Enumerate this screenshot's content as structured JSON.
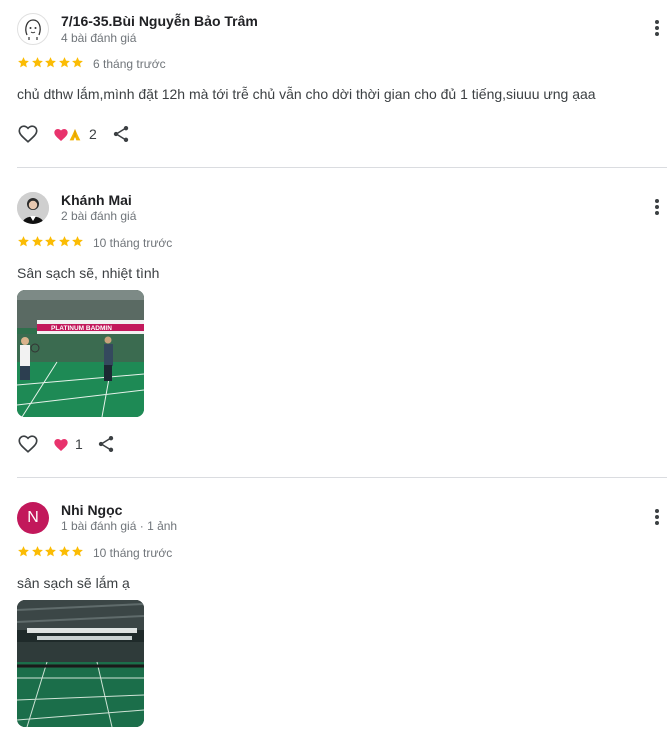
{
  "reviews": [
    {
      "name": "7/16-35.Bùi Nguyễn Bảo Trâm",
      "meta": "4 bài đánh giá",
      "rating": 5,
      "ago": "6 tháng trước",
      "text": "chủ dthw lắm,mình đặt 12h mà tới trễ chủ vẫn cho dời thời gian cho đủ 1 tiếng,siuuu ưng ạaa",
      "reaction_count": "2",
      "reaction_icons": [
        "heart-emoji-icon",
        "praying-hands-emoji-icon"
      ]
    },
    {
      "name": "Khánh Mai",
      "meta": "2 bài đánh giá",
      "rating": 5,
      "ago": "10 tháng trước",
      "text": "Sân sạch sẽ, nhiệt tình",
      "reaction_count": "1",
      "photo_banner": "PLATINUM BADMIN",
      "reaction_icons": [
        "heart-emoji-icon"
      ]
    },
    {
      "name": "Nhi Ngọc",
      "avatar_letter": "N",
      "avatar_color": "#c2185b",
      "meta": "1 bài đánh giá · 1 ảnh",
      "rating": 5,
      "ago": "10 tháng trước",
      "text": "sân sạch sẽ lắm ạ"
    }
  ],
  "colors": {
    "star": "#fbbc04",
    "court_green": "#1e8a55",
    "divider": "#dadce0"
  }
}
